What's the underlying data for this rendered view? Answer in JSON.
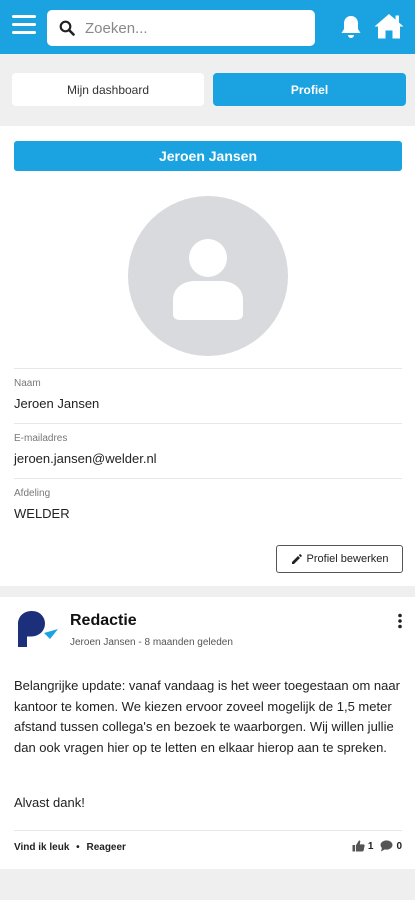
{
  "header": {
    "search_placeholder": "Zoeken..."
  },
  "tabs": [
    {
      "label": "Mijn dashboard",
      "active": false
    },
    {
      "label": "Profiel",
      "active": true
    }
  ],
  "profile": {
    "name": "Jeroen Jansen",
    "fields": [
      {
        "label": "Naam",
        "value": "Jeroen Jansen"
      },
      {
        "label": "E-mailadres",
        "value": "jeroen.jansen@welder.nl"
      },
      {
        "label": "Afdeling",
        "value": "WELDER"
      }
    ],
    "edit_label": "Profiel bewerken"
  },
  "post": {
    "author": "Redactie",
    "meta": "Jeroen Jansen - 8 maanden geleden",
    "body": "Belangrijke update: vanaf vandaag is het weer toegestaan om naar kantoor te komen. We kiezen ervoor zoveel mogelijk de 1,5 meter afstand tussen collega's en bezoek te waarborgen. Wij willen jullie dan ook vragen hier op te letten en elkaar hierop aan te spreken.",
    "closing": "Alvast dank!",
    "like_label": "Vind ik leuk",
    "separator": "•",
    "reply_label": "Reageer",
    "like_count": "1",
    "comment_count": "0"
  },
  "colors": {
    "accent": "#1aa3e0",
    "brand_dark": "#1c2f7a",
    "background": "#efefef"
  },
  "icons": [
    "menu-icon",
    "search-icon",
    "bell-icon",
    "home-icon",
    "user-silhouette-icon",
    "pencil-icon",
    "redactie-logo",
    "kebab-menu-icon",
    "thumbs-up-icon",
    "comment-icon"
  ]
}
